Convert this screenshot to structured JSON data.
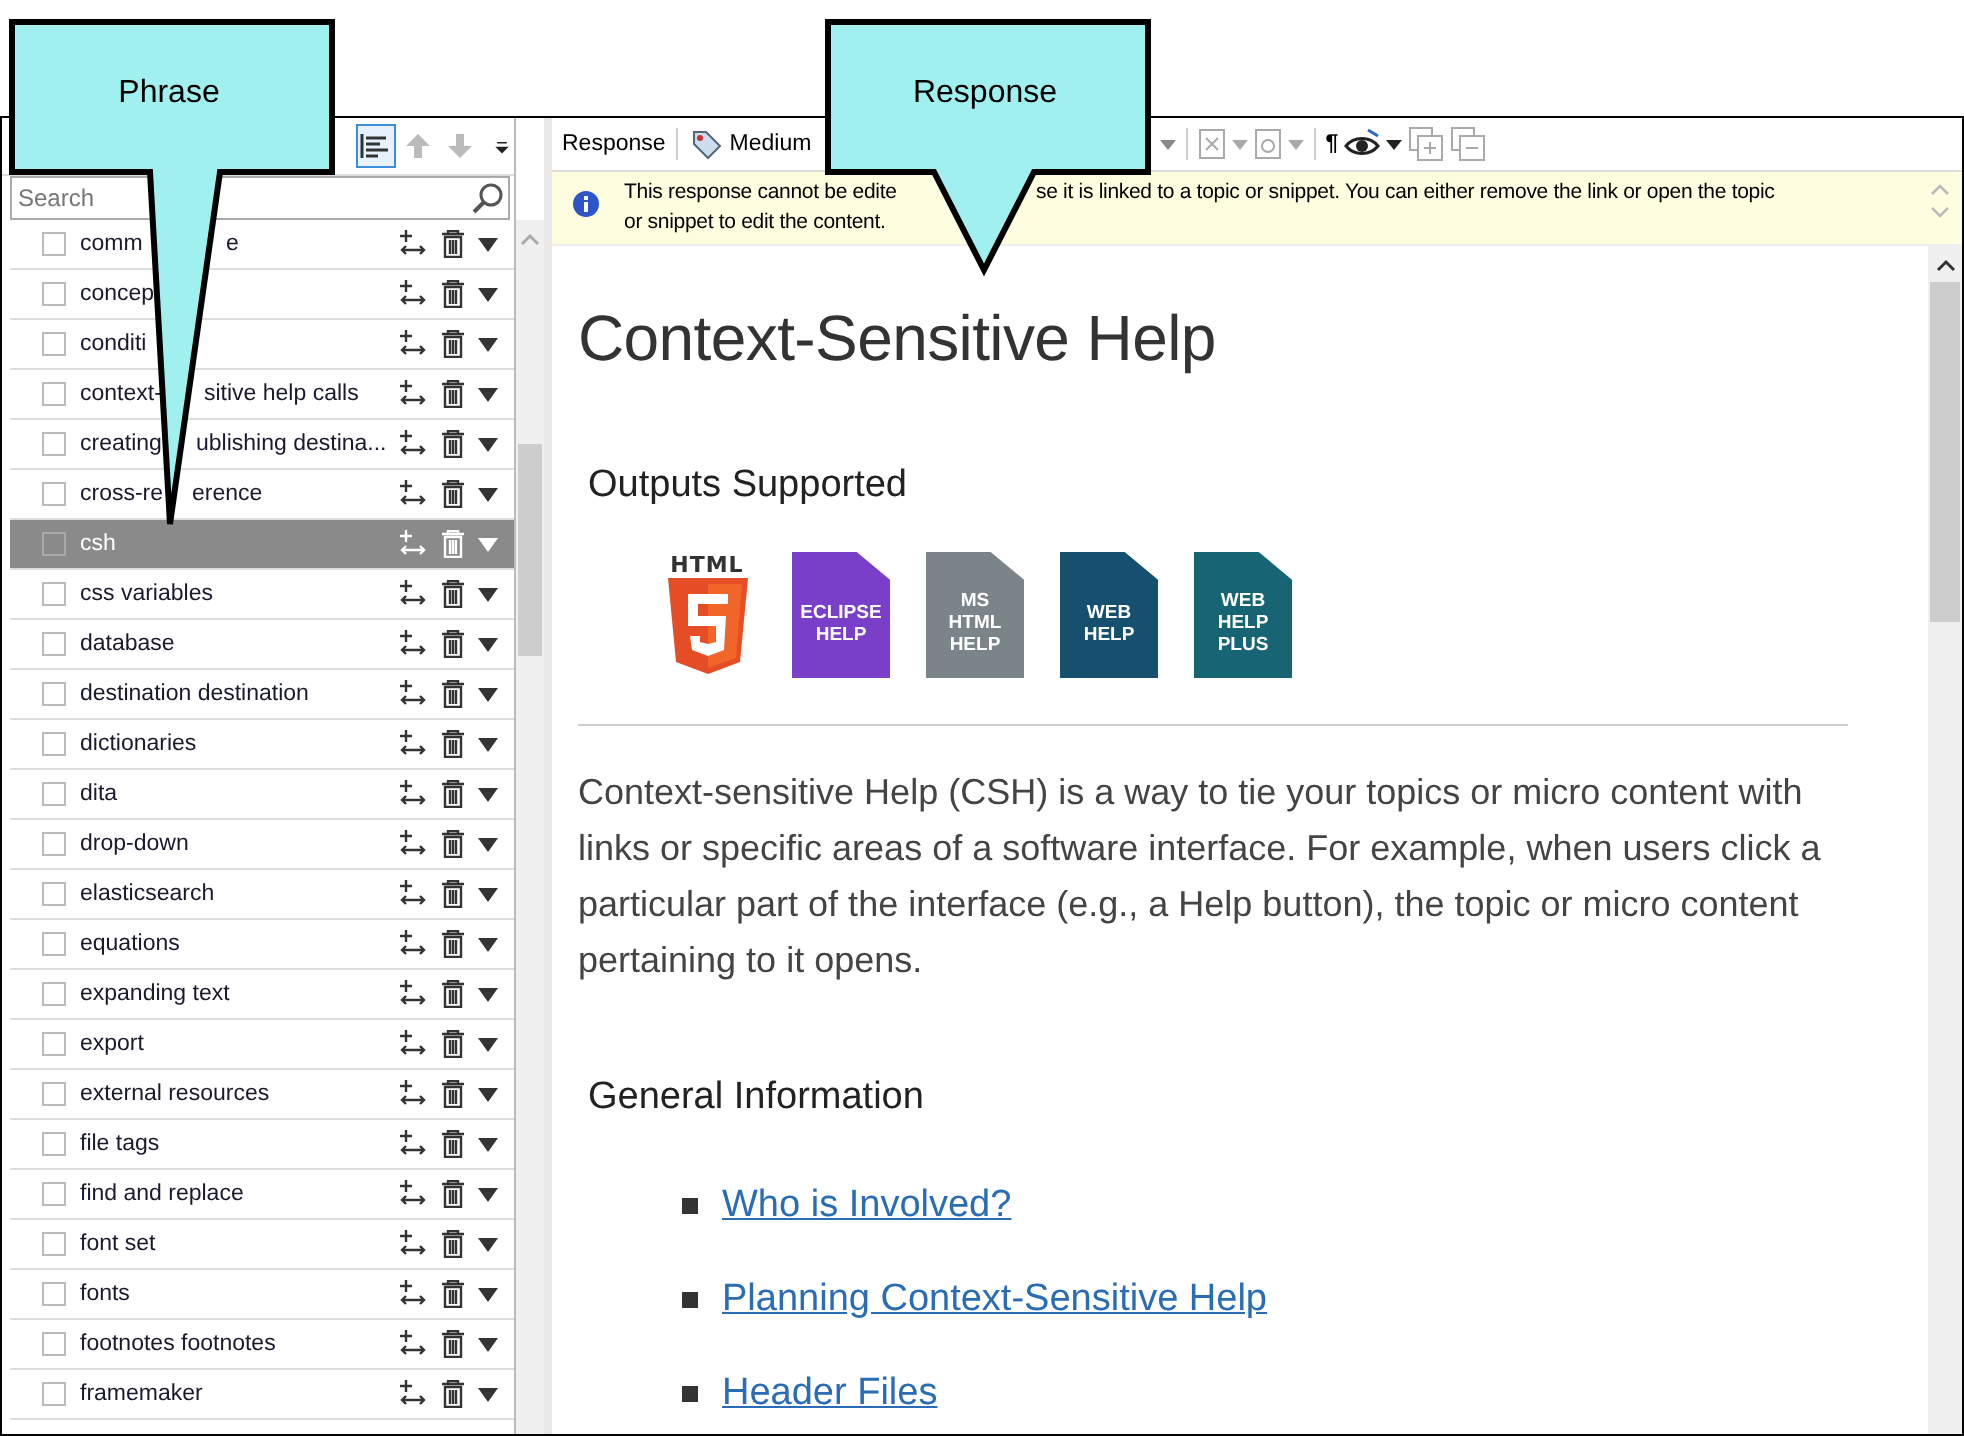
{
  "callouts": [
    {
      "text": "Phrase"
    },
    {
      "text": "Response"
    }
  ],
  "phrase_pane": {
    "toolbar": [
      {
        "kind": "sort",
        "on": true,
        "disabled": false
      },
      {
        "kind": "up",
        "on": false,
        "disabled": true
      },
      {
        "kind": "down",
        "on": false,
        "disabled": true
      }
    ],
    "search": {
      "placeholder": "Search"
    },
    "items": [
      {
        "label": "comm",
        "label_tail": "e",
        "checked": false,
        "selected": false
      },
      {
        "label": "concep",
        "checked": false,
        "selected": false
      },
      {
        "label": "conditi",
        "checked": false,
        "selected": false
      },
      {
        "label": "context-",
        "label_tail": "sitive help calls",
        "checked": false,
        "selected": false
      },
      {
        "label": "creating",
        "label_tail": "ublishing destina...",
        "checked": false,
        "selected": false
      },
      {
        "label": "cross-re",
        "label_tail": "erence",
        "checked": false,
        "selected": false
      },
      {
        "label": "csh",
        "checked": false,
        "selected": true
      },
      {
        "label": "css variables",
        "checked": false,
        "selected": false
      },
      {
        "label": "database",
        "checked": false,
        "selected": false
      },
      {
        "label": "destination destination",
        "checked": false,
        "selected": false
      },
      {
        "label": "dictionaries",
        "checked": false,
        "selected": false
      },
      {
        "label": "dita",
        "checked": false,
        "selected": false
      },
      {
        "label": "drop-down",
        "checked": false,
        "selected": false
      },
      {
        "label": "elasticsearch",
        "checked": false,
        "selected": false
      },
      {
        "label": "equations",
        "checked": false,
        "selected": false
      },
      {
        "label": "expanding text",
        "checked": false,
        "selected": false
      },
      {
        "label": "export",
        "checked": false,
        "selected": false
      },
      {
        "label": "external resources",
        "checked": false,
        "selected": false
      },
      {
        "label": "file tags",
        "checked": false,
        "selected": false
      },
      {
        "label": "find and replace",
        "checked": false,
        "selected": false
      },
      {
        "label": "font set",
        "checked": false,
        "selected": false
      },
      {
        "label": "fonts",
        "checked": false,
        "selected": false
      },
      {
        "label": "footnotes footnotes",
        "checked": false,
        "selected": false
      },
      {
        "label": "framemaker",
        "checked": false,
        "selected": false
      }
    ]
  },
  "response_pane": {
    "toolbar": {
      "label": "Response",
      "style": "Medium",
      "pilcrow": "¶"
    },
    "notice": {
      "line1_start": "This response cannot be edite",
      "line1_end": "se it is linked to a topic or snippet. You can either remove the link or open the topic",
      "line2": "or snippet to edit the content."
    },
    "content": {
      "title": "Context-Sensitive Help",
      "outputs_heading": "Outputs Supported",
      "outputs": [
        {
          "kind": "logo",
          "label": "HTML"
        },
        {
          "kind": "doc",
          "label": "ECLIPSE\nHELP",
          "color": "#7a3fc9"
        },
        {
          "kind": "doc",
          "label": "MS\nHTML\nHELP",
          "color": "#7b8489"
        },
        {
          "kind": "doc",
          "label": "WEB\nHELP",
          "color": "#17506f"
        },
        {
          "kind": "doc",
          "label": "WEB\nHELP\nPLUS",
          "color": "#176574"
        }
      ],
      "intro": "Context-sensitive Help (CSH) is a way to tie your topics or micro content with links or specific areas of a software interface. For example, when users click a particular part of the interface (e.g., a Help button), the topic or micro content pertaining to it opens.",
      "section_heading": "General Information",
      "links": [
        "Who is Involved?",
        "Planning Context-Sensitive Help",
        "Header Files"
      ]
    }
  }
}
